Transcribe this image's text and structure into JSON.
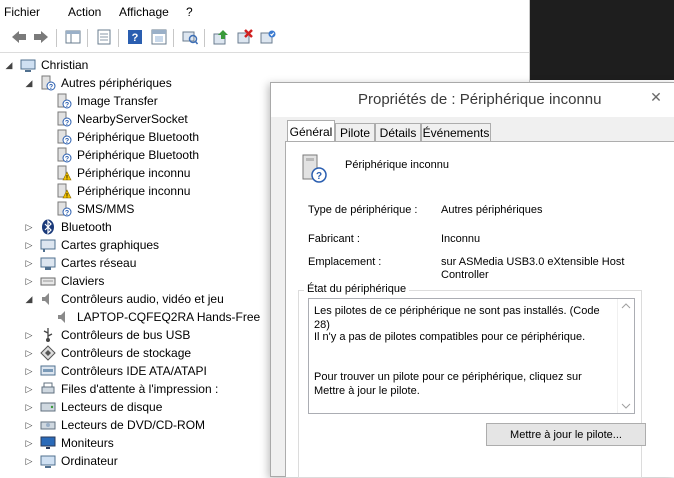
{
  "menu": {
    "file": "Fichier",
    "action": "Action",
    "view": "Affichage",
    "help": "?"
  },
  "tree": {
    "root": "Christian",
    "items": [
      {
        "label": "Autres périphériques",
        "icon": "unknown-device-icon"
      },
      {
        "label": "Image Transfer",
        "icon": "unknown-device-icon"
      },
      {
        "label": "NearbyServerSocket",
        "icon": "unknown-device-icon"
      },
      {
        "label": "Périphérique Bluetooth",
        "icon": "unknown-device-icon"
      },
      {
        "label": "Périphérique Bluetooth",
        "icon": "unknown-device-icon"
      },
      {
        "label": "Périphérique inconnu",
        "icon": "warning-device-icon"
      },
      {
        "label": "Périphérique inconnu",
        "icon": "warning-device-icon"
      },
      {
        "label": "SMS/MMS",
        "icon": "unknown-device-icon"
      },
      {
        "label": "Bluetooth",
        "icon": "bluetooth-icon"
      },
      {
        "label": "Cartes graphiques",
        "icon": "display-adapter-icon"
      },
      {
        "label": "Cartes réseau",
        "icon": "network-adapter-icon"
      },
      {
        "label": "Claviers",
        "icon": "keyboard-icon"
      },
      {
        "label": "Contrôleurs audio, vidéo et jeu",
        "icon": "speaker-icon"
      },
      {
        "label": "LAPTOP-CQFEQ2RA Hands-Free",
        "icon": "speaker-icon"
      },
      {
        "label": "Contrôleurs de bus USB",
        "icon": "usb-icon"
      },
      {
        "label": "Contrôleurs de stockage",
        "icon": "storage-controller-icon"
      },
      {
        "label": "Contrôleurs IDE ATA/ATAPI",
        "icon": "ide-controller-icon"
      },
      {
        "label": "Files d'attente à l'impression :",
        "icon": "print-queue-icon"
      },
      {
        "label": "Lecteurs de disque",
        "icon": "disk-drive-icon"
      },
      {
        "label": "Lecteurs de DVD/CD-ROM",
        "icon": "dvd-drive-icon"
      },
      {
        "label": "Moniteurs",
        "icon": "monitor-icon"
      },
      {
        "label": "Ordinateur",
        "icon": "computer-icon"
      }
    ]
  },
  "dialog": {
    "title": "Propriétés de : Périphérique inconnu",
    "close": "✕",
    "tabs": [
      "Général",
      "Pilote",
      "Détails",
      "Événements"
    ],
    "device_name": "Périphérique inconnu",
    "fields": [
      {
        "key": "Type de périphérique :",
        "value": "Autres périphériques"
      },
      {
        "key": "Fabricant :",
        "value": "Inconnu"
      },
      {
        "key": "Emplacement :",
        "value": "sur ASMedia USB3.0 eXtensible Host Controller"
      }
    ],
    "status_legend": "État du périphérique",
    "status_lines": [
      "Les pilotes de ce périphérique ne sont pas installés. (Code 28)",
      "Il n'y a pas de pilotes compatibles pour ce périphérique.",
      "Pour trouver un pilote pour ce périphérique, cliquez sur Mettre à jour le pilote."
    ],
    "update_button": "Mettre à jour le pilote..."
  }
}
